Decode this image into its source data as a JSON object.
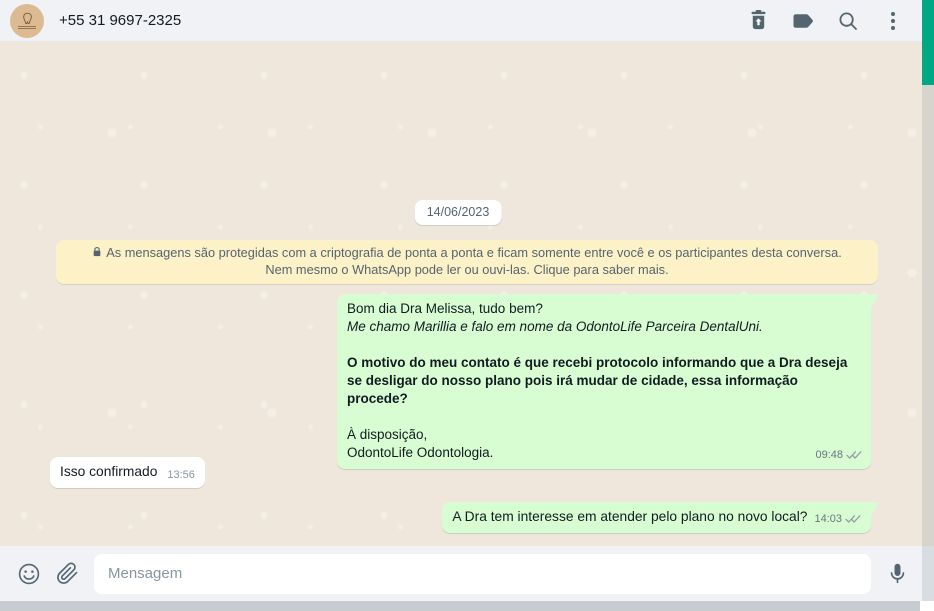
{
  "header": {
    "contact_phone": "+55 31 9697-2325"
  },
  "icons": {
    "avatar_logo": "tooth-logo",
    "header_actions": [
      "trash-delete-icon",
      "label-tag-icon",
      "search-icon",
      "kebab-menu-icon"
    ],
    "banner_icon": "lock-icon",
    "composer_icons": [
      "emoji-smiley-icon",
      "paperclip-icon",
      "microphone-icon"
    ],
    "message_status_icon": "double-check-gray"
  },
  "colors": {
    "outgoing_bubble": "#d9fdd3",
    "incoming_bubble": "#ffffff",
    "chat_background": "#efe7dc",
    "header_background": "#f0f2f5",
    "banner_background": "#fdf1c7",
    "scrollbar_thumb_green": "#00a884",
    "icon_slate": "#54656f",
    "check_gray": "#8fa0a8"
  },
  "chat": {
    "date_chip": "14/06/2023",
    "encryption_notice": "As mensagens são protegidas com a criptografia de ponta a ponta e ficam somente entre você e os participantes desta conversa. Nem mesmo o WhatsApp pode ler ou ouvi-las. Clique para saber mais.",
    "messages": [
      {
        "direction": "outgoing",
        "line_greeting": "Bom dia Dra Melissa, tudo bem?",
        "line_intro_italic": "Me chamo Marillia e falo em nome da OdontoLife Parceira DentalUni.",
        "paragraph_bold": "O motivo do meu contato é que recebi protocolo informando que a Dra deseja se desligar do nosso plano pois irá mudar de cidade, essa informação procede?",
        "closing_line1": "À disposição,",
        "closing_line2": "OdontoLife Odontologia.",
        "time": "09:48",
        "status": "delivered"
      },
      {
        "direction": "incoming",
        "text": "Isso confirmado",
        "time": "13:56"
      },
      {
        "direction": "outgoing",
        "text": "A Dra tem interesse em atender pelo plano no novo local?",
        "time": "14:03",
        "status": "delivered"
      }
    ]
  },
  "composer": {
    "placeholder": "Mensagem"
  }
}
